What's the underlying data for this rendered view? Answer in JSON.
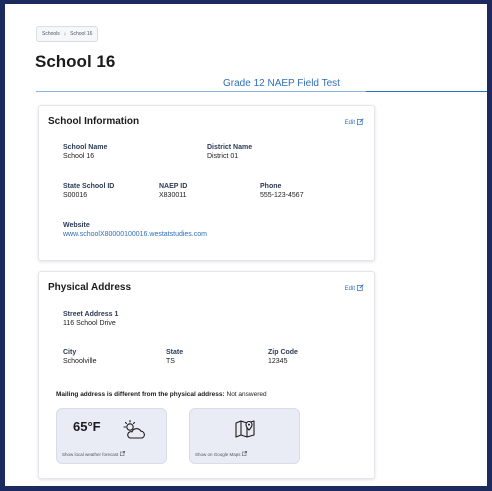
{
  "breadcrumb": {
    "items": [
      "Schools",
      "School 16"
    ]
  },
  "page": {
    "title": "School 16",
    "subtitle": "Grade 12 NAEP Field Test"
  },
  "school_info": {
    "title": "School Information",
    "edit_label": "Edit",
    "school_name_label": "School Name",
    "school_name_value": "School 16",
    "district_name_label": "District Name",
    "district_name_value": "District 01",
    "state_id_label": "State School ID",
    "state_id_value": "S00016",
    "naep_id_label": "NAEP ID",
    "naep_id_value": "X830011",
    "phone_label": "Phone",
    "phone_value": "555-123-4567",
    "website_label": "Website",
    "website_value": "www.schoolX80000100016.westatstudies.com"
  },
  "physical_address": {
    "title": "Physical Address",
    "edit_label": "Edit",
    "street_label": "Street Address 1",
    "street_value": "116 School Drive",
    "city_label": "City",
    "city_value": "Schoolville",
    "state_label": "State",
    "state_value": "TS",
    "zip_label": "Zip Code",
    "zip_value": "12345",
    "mailing_label": "Mailing address is different from the physical address:",
    "mailing_value": "Not answered",
    "weather_temp": "65°F",
    "weather_caption": "Show local weather forecast",
    "maps_caption": "Show on Google Maps"
  },
  "colors": {
    "accent": "#2f6fb8",
    "frame": "#1c2a5e"
  },
  "icons": [
    "edit-icon",
    "partly-cloudy-icon",
    "map-pin-icon",
    "external-link-icon"
  ]
}
